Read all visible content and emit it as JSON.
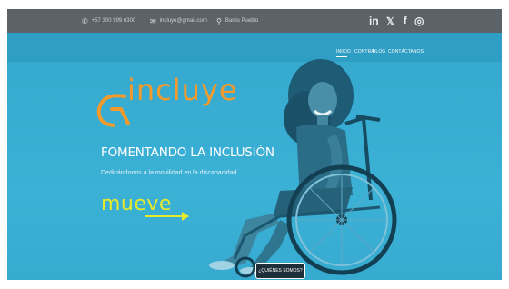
{
  "topbar": {
    "phone": "+57 300 999 6300",
    "email": "incluye@gmail.com",
    "location": "Barrio Pueblo",
    "social": [
      "in",
      "𝕏",
      "f",
      "◎"
    ]
  },
  "nav": {
    "items": [
      "INICIO",
      "CONTRA",
      "BLOG",
      "CONTÁCTANOS"
    ]
  },
  "hero": {
    "logo": "incluye",
    "tagline": "FOMENTANDO LA INCLUSIÓN",
    "subtitle": "Dedicándonos a la movilidad en la discapacidad",
    "brand_word": "mueve",
    "cta": "¿QUIÉNES SOMOS?"
  },
  "colors": {
    "top_bar": "#5b6368",
    "hero_blue": "#3aaed2",
    "logo_orange": "#f39a2c",
    "mueve_yellow": "#e6ea2a",
    "cta_dark": "#1f2f3a"
  }
}
